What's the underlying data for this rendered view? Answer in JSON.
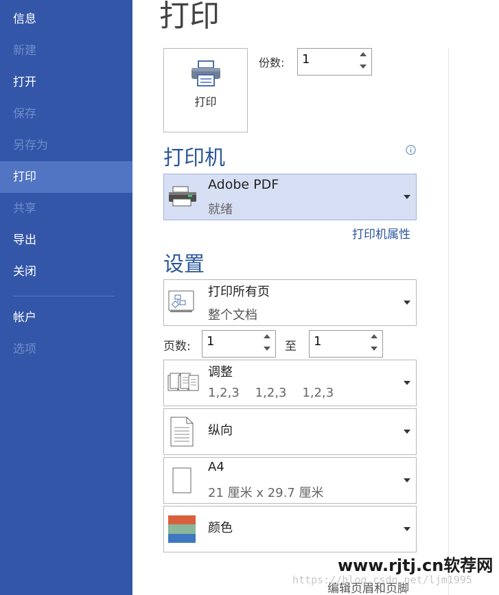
{
  "sidebar": {
    "items": [
      {
        "label": "信息",
        "state": "normal"
      },
      {
        "label": "新建",
        "state": "disabled"
      },
      {
        "label": "打开",
        "state": "normal"
      },
      {
        "label": "保存",
        "state": "disabled"
      },
      {
        "label": "另存为",
        "state": "disabled"
      },
      {
        "label": "打印",
        "state": "active"
      },
      {
        "label": "共享",
        "state": "disabled"
      },
      {
        "label": "导出",
        "state": "normal"
      },
      {
        "label": "关闭",
        "state": "normal"
      },
      {
        "label": "帐户",
        "state": "normal"
      },
      {
        "label": "选项",
        "state": "disabled"
      }
    ]
  },
  "main": {
    "title": "打印",
    "print_button_label": "打印",
    "copies_label": "份数:",
    "copies_value": "1",
    "printer_heading": "打印机",
    "printer": {
      "name": "Adobe PDF",
      "status": "就绪"
    },
    "printer_properties_link": "打印机属性",
    "settings_heading": "设置",
    "print_range": {
      "title": "打印所有页",
      "subtitle": "整个文档"
    },
    "pages_label": "页数:",
    "pages_from": "1",
    "to_label": "至",
    "pages_to": "1",
    "collate": {
      "title": "调整",
      "subtitle": "1,2,3    1,2,3    1,2,3"
    },
    "orientation": {
      "title": "纵向"
    },
    "paper": {
      "title": "A4",
      "subtitle": "21 厘米 x 29.7 厘米"
    },
    "color": {
      "title": "颜色"
    },
    "footer_link": "编辑页眉和页脚"
  },
  "watermark": {
    "site": "www.rjtj.cn软荐网",
    "blog": "https://blog.csdn.net/ljm1995"
  },
  "colors": {
    "sidebar_bg": "#3456a8",
    "sidebar_active": "#5275c3",
    "accent": "#2b579a",
    "selected_bg": "#d7dff4"
  },
  "icons": [
    "printer-icon",
    "info-icon",
    "pdf-printer-icon",
    "pages-icon",
    "collate-icon",
    "portrait-icon",
    "a4-paper-icon",
    "color-icon",
    "spin-up-icon",
    "spin-down-icon",
    "dropdown-caret-icon"
  ]
}
